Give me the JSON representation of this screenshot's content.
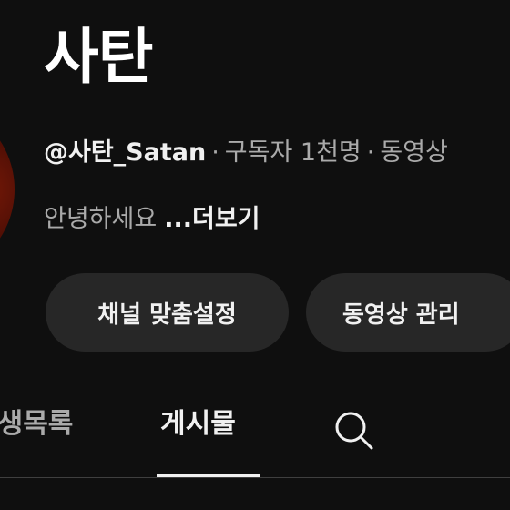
{
  "channel": {
    "title": "사탄",
    "handle": "@사탄_Satan",
    "separator": "·",
    "subscribers": "구독자 1천명",
    "videos": "동영상",
    "description": "안녕하세요",
    "more_label": "...더보기"
  },
  "actions": {
    "customize_label": "채널 맞춤설정",
    "manage_videos_label": "동영상 관리"
  },
  "tabs": [
    {
      "label": "재생목록",
      "selected": false
    },
    {
      "label": "게시물",
      "selected": true
    }
  ],
  "icons": {
    "search": "search-icon"
  },
  "colors": {
    "background": "#0f0f0f",
    "button_bg": "#272727",
    "text_primary": "#f1f1f1",
    "text_secondary": "#aaaaaa"
  }
}
